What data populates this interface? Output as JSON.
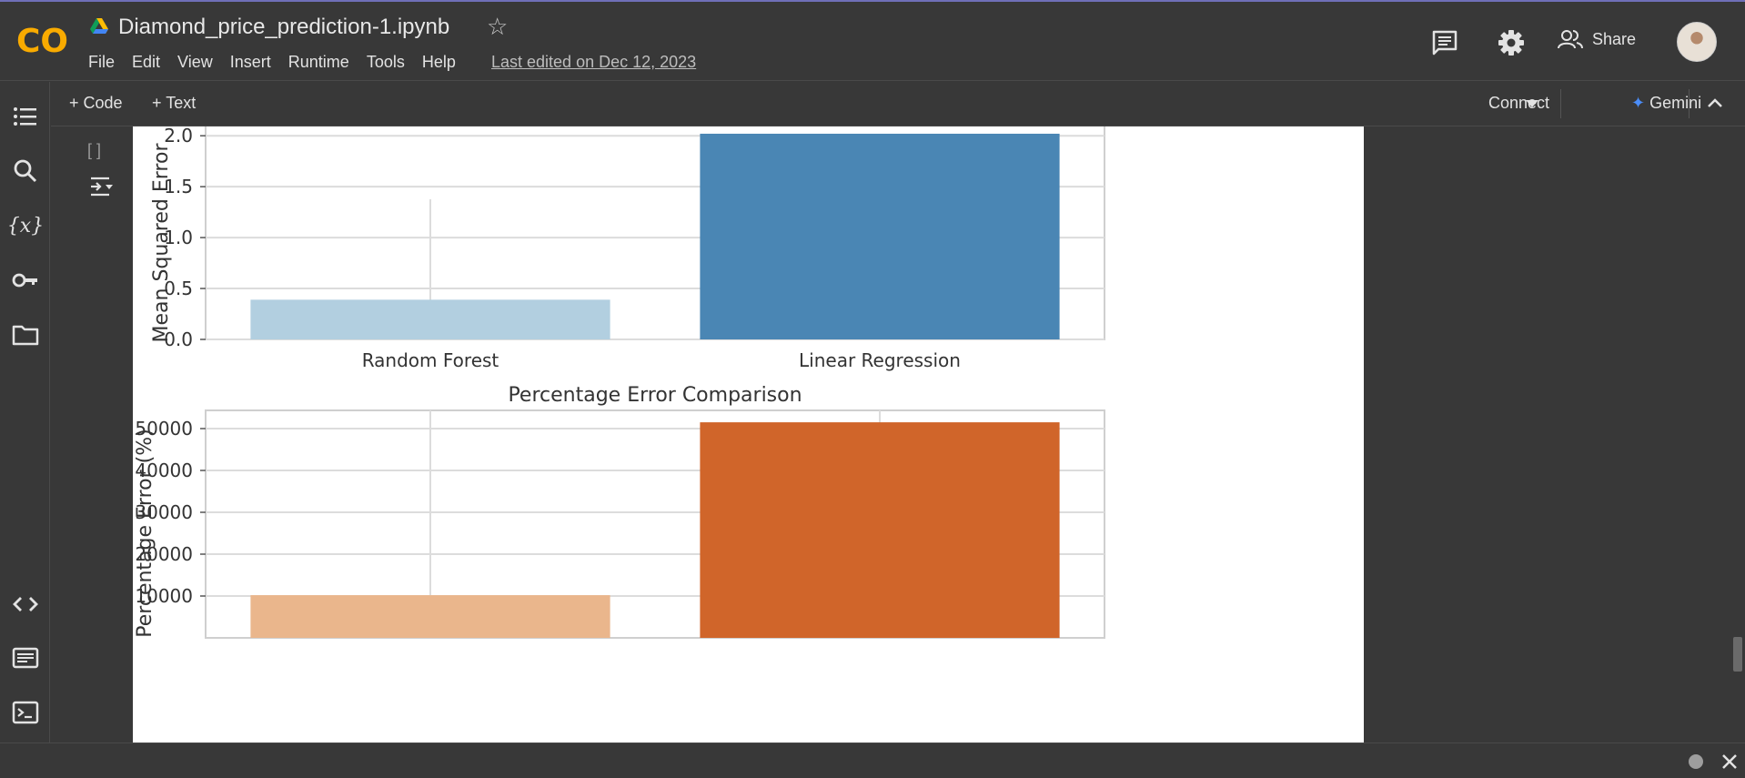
{
  "app": {
    "notebook_title": "Diamond_price_prediction-1.ipynb",
    "logo_text": "CO",
    "last_edited": "Last edited on Dec 12, 2023",
    "share_label": "Share"
  },
  "menu": [
    "File",
    "Edit",
    "View",
    "Insert",
    "Runtime",
    "Tools",
    "Help"
  ],
  "toolbar": {
    "add_code": "Code",
    "add_text": "Text",
    "connect": "Connect",
    "gemini": "Gemini"
  },
  "cell": {
    "run_marker": "[ ]"
  },
  "colors": {
    "accent_blue": "#4a86b4",
    "light_blue": "#b2cfe0",
    "dark_orange": "#d0652a",
    "light_orange": "#eab68c",
    "chrome_bg": "#383838"
  },
  "chart_data": [
    {
      "type": "bar",
      "title": "",
      "scale_note": "1e6",
      "categories": [
        "Random Forest",
        "Linear Regression"
      ],
      "values": [
        0.39,
        2.02
      ],
      "ylabel": "Mean Squared Error",
      "yticks": [
        "0.0",
        "0.5",
        "1.0",
        "1.5",
        "2.0"
      ],
      "ylim": [
        0,
        2.1
      ],
      "grid": true,
      "bar_colors": [
        "#b2cfe0",
        "#4a86b4"
      ]
    },
    {
      "type": "bar",
      "title": "Percentage Error Comparison",
      "categories": [
        "Random Forest",
        "Linear Regression"
      ],
      "values": [
        10200,
        51500
      ],
      "ylabel": "Percentage Error (%)",
      "yticks": [
        "10000",
        "20000",
        "30000",
        "40000",
        "50000"
      ],
      "ylim": [
        0,
        54000
      ],
      "grid": true,
      "bar_colors": [
        "#eab68c",
        "#d0652a"
      ]
    }
  ]
}
